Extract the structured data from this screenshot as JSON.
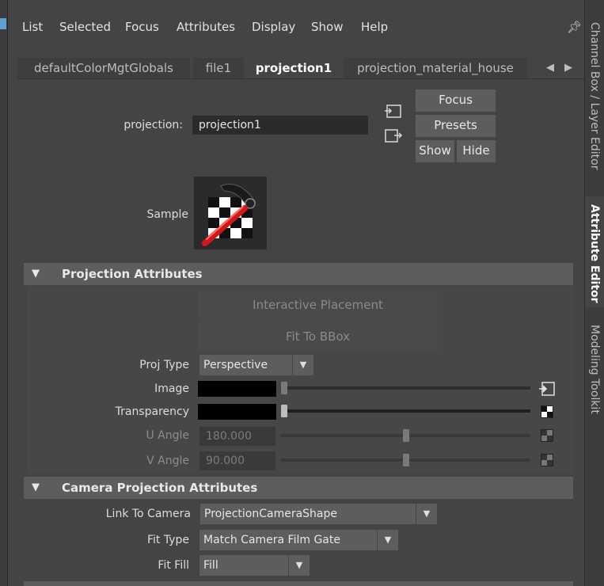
{
  "menu": [
    "List",
    "Selected",
    "Focus",
    "Attributes",
    "Display",
    "Show",
    "Help"
  ],
  "tabs": [
    {
      "label": "defaultColorMgtGlobals",
      "active": false
    },
    {
      "label": "file1",
      "active": false
    },
    {
      "label": "projection1",
      "active": true
    },
    {
      "label": "projection_material_house",
      "active": false
    }
  ],
  "node": {
    "type_label": "projection:",
    "name": "projection1",
    "buttons": {
      "focus": "Focus",
      "presets": "Presets",
      "show": "Show",
      "hide": "Hide"
    },
    "sample_label": "Sample"
  },
  "projection_section": {
    "title": "Projection Attributes",
    "interactive_placement": "Interactive Placement",
    "fit_to_bbox": "Fit To BBox",
    "proj_type": {
      "label": "Proj Type",
      "value": "Perspective"
    },
    "image": {
      "label": "Image",
      "color": "#000000",
      "slider": 0.0
    },
    "transparency": {
      "label": "Transparency",
      "color": "#000000",
      "slider": 0.0
    },
    "u_angle": {
      "label": "U Angle",
      "value": "180.000",
      "slider": 0.5
    },
    "v_angle": {
      "label": "V Angle",
      "value": "90.000",
      "slider": 0.5
    }
  },
  "camera_section": {
    "title": "Camera Projection Attributes",
    "link_to_camera": {
      "label": "Link To Camera",
      "value": "ProjectionCameraShape"
    },
    "fit_type": {
      "label": "Fit Type",
      "value": "Match Camera Film Gate"
    },
    "fit_fill": {
      "label": "Fit Fill",
      "value": "Fill"
    }
  },
  "side_tabs": [
    {
      "label": "Channel Box / Layer Editor",
      "active": false
    },
    {
      "label": "Attribute Editor",
      "active": true
    },
    {
      "label": "Modeling Toolkit",
      "active": false
    }
  ],
  "icons": {
    "pin": "pin-icon",
    "collapse": "triangle-down-icon",
    "nav_left": "arrow-left-icon",
    "nav_right": "arrow-right-icon"
  }
}
